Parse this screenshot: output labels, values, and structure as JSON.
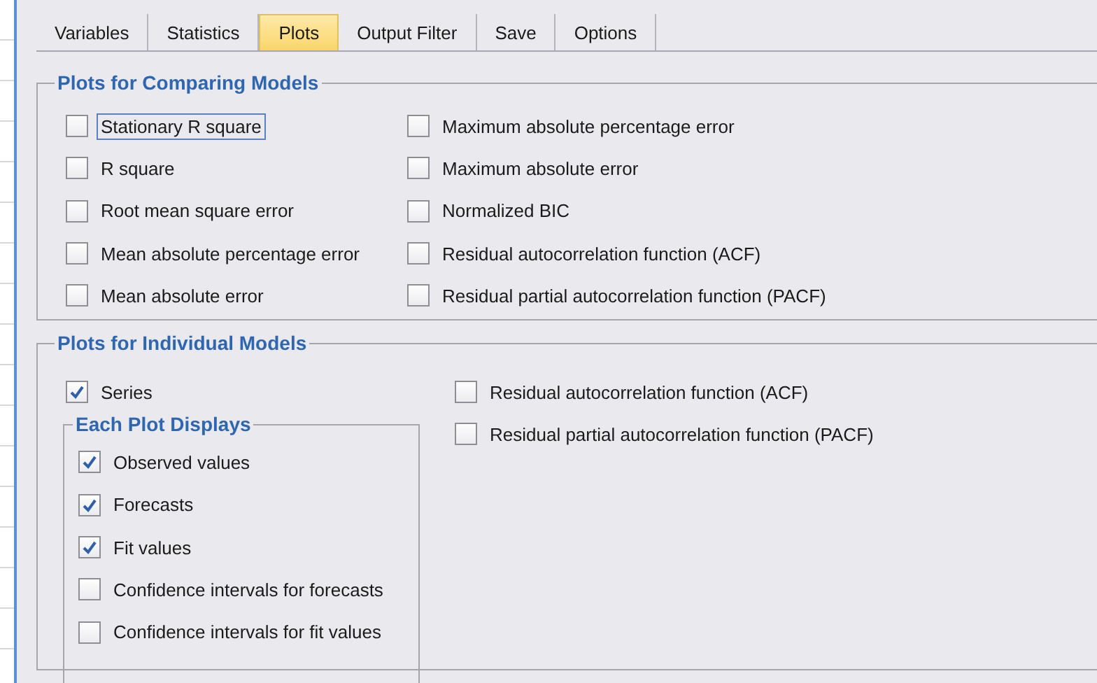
{
  "tabs": [
    {
      "label": "Variables",
      "selected": false
    },
    {
      "label": "Statistics",
      "selected": false
    },
    {
      "label": "Plots",
      "selected": true
    },
    {
      "label": "Output Filter",
      "selected": false
    },
    {
      "label": "Save",
      "selected": false
    },
    {
      "label": "Options",
      "selected": false
    }
  ],
  "comparing": {
    "title": "Plots for Comparing Models",
    "columns": [
      [
        {
          "label": "Stationary R square",
          "checked": false,
          "focused": true
        },
        {
          "label": "R square",
          "checked": false,
          "focused": false
        },
        {
          "label": "Root mean square error",
          "checked": false,
          "focused": false
        },
        {
          "label": "Mean absolute percentage error",
          "checked": false,
          "focused": false
        },
        {
          "label": "Mean absolute error",
          "checked": false,
          "focused": false
        }
      ],
      [
        {
          "label": "Maximum absolute percentage error",
          "checked": false,
          "focused": false
        },
        {
          "label": "Maximum absolute error",
          "checked": false,
          "focused": false
        },
        {
          "label": "Normalized BIC",
          "checked": false,
          "focused": false
        },
        {
          "label": "Residual autocorrelation function (ACF)",
          "checked": false,
          "focused": false
        },
        {
          "label": "Residual partial autocorrelation function (PACF)",
          "checked": false,
          "focused": false
        }
      ]
    ]
  },
  "individual": {
    "title": "Plots for Individual Models",
    "series": {
      "label": "Series",
      "checked": true,
      "focused": false
    },
    "each_plot": {
      "title": "Each Plot Displays",
      "items": [
        {
          "label": "Observed values",
          "checked": true,
          "focused": false
        },
        {
          "label": "Forecasts",
          "checked": true,
          "focused": false
        },
        {
          "label": "Fit values",
          "checked": true,
          "focused": false
        },
        {
          "label": "Confidence intervals for forecasts",
          "checked": false,
          "focused": false
        },
        {
          "label": "Confidence intervals for fit values",
          "checked": false,
          "focused": false
        }
      ]
    },
    "right": [
      {
        "label": "Residual autocorrelation function (ACF)",
        "checked": false,
        "focused": false
      },
      {
        "label": "Residual partial autocorrelation function (PACF)",
        "checked": false,
        "focused": false
      }
    ]
  }
}
